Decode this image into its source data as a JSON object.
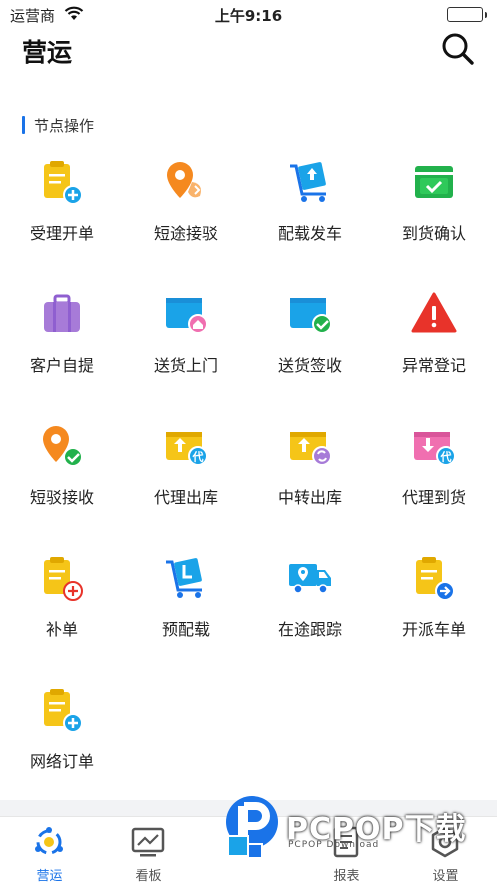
{
  "status_bar": {
    "carrier": "运营商",
    "time": "上午9:16"
  },
  "nav": {
    "title": "营运",
    "search_icon": "search-icon"
  },
  "section": {
    "title": "节点操作"
  },
  "grid_items": [
    {
      "label": "受理开单",
      "icon": "clipboard-add-icon"
    },
    {
      "label": "短途接驳",
      "icon": "location-transfer-icon"
    },
    {
      "label": "配载发车",
      "icon": "cart-upload-icon"
    },
    {
      "label": "到货确认",
      "icon": "inbox-check-icon"
    },
    {
      "label": "客户自提",
      "icon": "luggage-icon"
    },
    {
      "label": "送货上门",
      "icon": "folder-home-icon"
    },
    {
      "label": "送货签收",
      "icon": "folder-check-icon"
    },
    {
      "label": "异常登记",
      "icon": "warning-icon"
    },
    {
      "label": "短驳接收",
      "icon": "location-check-icon"
    },
    {
      "label": "代理出库",
      "icon": "box-out-agent-icon"
    },
    {
      "label": "中转出库",
      "icon": "box-transfer-icon"
    },
    {
      "label": "代理到货",
      "icon": "box-in-agent-icon"
    },
    {
      "label": "补单",
      "icon": "clipboard-plus-icon"
    },
    {
      "label": "预配载",
      "icon": "cart-load-icon"
    },
    {
      "label": "在途跟踪",
      "icon": "truck-location-icon"
    },
    {
      "label": "开派车单",
      "icon": "clipboard-dispatch-icon"
    },
    {
      "label": "网络订单",
      "icon": "clipboard-network-icon"
    }
  ],
  "tabs": [
    {
      "label": "营运",
      "icon": "operations-icon",
      "active": true
    },
    {
      "label": "看板",
      "icon": "dashboard-icon",
      "active": false
    },
    {
      "label": "",
      "icon": "center-icon",
      "active": false
    },
    {
      "label": "报表",
      "icon": "report-icon",
      "active": false
    },
    {
      "label": "设置",
      "icon": "settings-icon",
      "active": false
    }
  ],
  "watermark": {
    "title": "PCPOP下载",
    "subtitle": "PCPOP Download"
  },
  "colors": {
    "accent": "#1a73e8",
    "yellow": "#f5c518",
    "orange": "#f5891f",
    "blue": "#1aa3e8",
    "green": "#22b14c",
    "purple": "#a77bd8",
    "red": "#e8332a",
    "pink": "#f06fb0"
  }
}
